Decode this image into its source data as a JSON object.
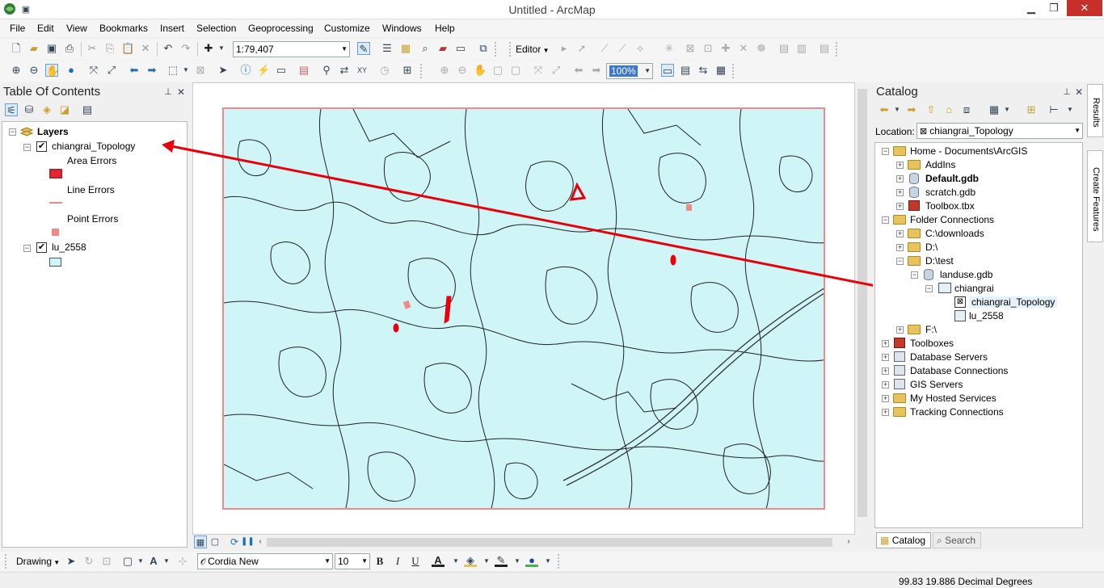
{
  "window": {
    "title": "Untitled - ArcMap"
  },
  "menu": [
    "File",
    "Edit",
    "View",
    "Bookmarks",
    "Insert",
    "Selection",
    "Geoprocessing",
    "Customize",
    "Windows",
    "Help"
  ],
  "toolbar": {
    "scale": "1:79,407",
    "editor_label": "Editor",
    "zoom_pct": "100%"
  },
  "toc": {
    "title": "Table Of Contents",
    "root": "Layers",
    "layers": [
      {
        "name": "chiangrai_Topology",
        "checked": true,
        "legend": [
          "Area Errors",
          "Line Errors",
          "Point Errors"
        ]
      },
      {
        "name": "lu_2558",
        "checked": true
      }
    ]
  },
  "catalog": {
    "title": "Catalog",
    "location_label": "Location:",
    "location_value": "chiangrai_Topology",
    "items": [
      "Home - Documents\\ArcGIS",
      "AddIns",
      "Default.gdb",
      "scratch.gdb",
      "Toolbox.tbx",
      "Folder Connections",
      "C:\\downloads",
      "D:\\",
      "D:\\test",
      "landuse.gdb",
      "chiangrai",
      "chiangrai_Topology",
      "lu_2558",
      "F:\\",
      "Toolboxes",
      "Database Servers",
      "Database Connections",
      "GIS Servers",
      "My Hosted Services",
      "Tracking Connections"
    ],
    "tabs": [
      "Catalog",
      "Search"
    ]
  },
  "side_tabs": [
    "Results",
    "Create Features"
  ],
  "drawing": {
    "label": "Drawing",
    "font": "Cordia New",
    "size": "10",
    "bold": "B",
    "italic": "I",
    "underline": "U",
    "fontcolor": "A"
  },
  "status": {
    "coords": "99.83  19.886 Decimal Degrees"
  },
  "colors": {
    "map_bg": "#cff5f7",
    "error_red": "#e8000b",
    "frame": "#f08a8a"
  }
}
